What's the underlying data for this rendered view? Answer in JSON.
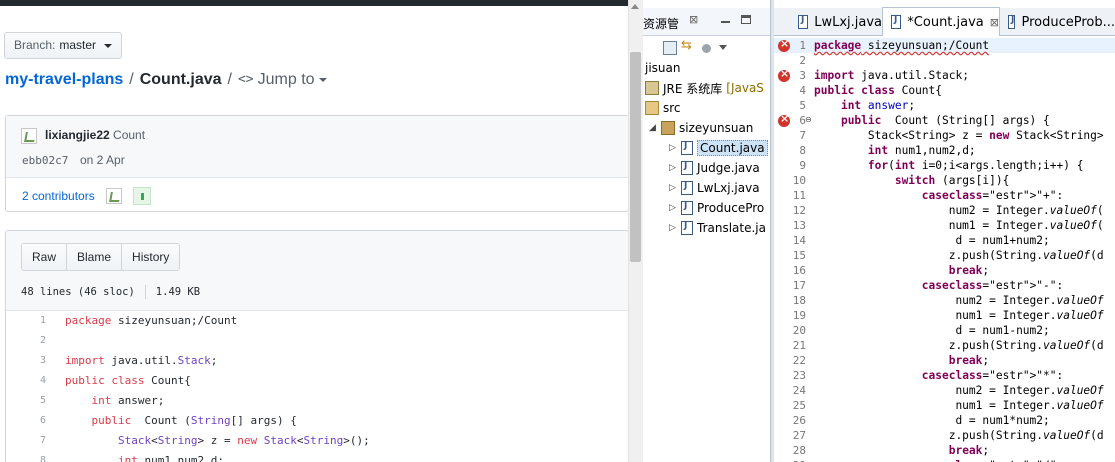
{
  "github": {
    "branch_label": "Branch:",
    "branch_name": "master",
    "repo_name": "my-travel-plans",
    "path_sep": "/",
    "file_name": "Count.java",
    "jump_code": "<>",
    "jump_label": "Jump to",
    "commit": {
      "author": "lixiangjie22",
      "message": "Count",
      "sha": "ebb02c7",
      "date": "on 2 Apr",
      "contributors": "2 contributors"
    },
    "file_actions": [
      "Raw",
      "Blame",
      "History"
    ],
    "lines_info": "48 lines (46 sloc)",
    "size_info": "1.49 KB",
    "code_lines": [
      {
        "n": "1",
        "text": "package sizeyunsuan;/Count"
      },
      {
        "n": "2",
        "text": ""
      },
      {
        "n": "3",
        "text": "import java.util.Stack;"
      },
      {
        "n": "4",
        "text": "public class Count{"
      },
      {
        "n": "5",
        "text": "    int answer;"
      },
      {
        "n": "6",
        "text": "    public  Count (String[] args) {"
      },
      {
        "n": "7",
        "text": "        Stack<String> z = new Stack<String>();"
      },
      {
        "n": "8",
        "text": "        int num1,num2,d;"
      }
    ]
  },
  "eclipse": {
    "explorer_title": "资源管",
    "explorer_close": "⊠",
    "tree": {
      "project": "jisuan",
      "jre": "JRE 系统库",
      "jre_suffix": "[JavaS",
      "src": "src",
      "package": "sizeyunsuan",
      "files": [
        "Count.java",
        "Judge.java",
        "LwLxj.java",
        "ProducePro",
        "Translate.ja"
      ]
    },
    "tabs": [
      {
        "label": "LwLxj.java",
        "active": false
      },
      {
        "label": "*Count.java",
        "active": true
      },
      {
        "label": "ProduceProb...",
        "active": false
      }
    ],
    "tab_close": "⊠",
    "code_lines": [
      {
        "n": "1",
        "text": "package sizeyunsuan;/Count"
      },
      {
        "n": "2",
        "text": ""
      },
      {
        "n": "3",
        "text": "import java.util.Stack;"
      },
      {
        "n": "4",
        "text": "public class Count{"
      },
      {
        "n": "5",
        "text": "    int answer;"
      },
      {
        "n": "6",
        "text": "    public  Count (String[] args) {"
      },
      {
        "n": "7",
        "text": "        Stack<String> z = new Stack<String>"
      },
      {
        "n": "8",
        "text": "        int num1,num2,d;"
      },
      {
        "n": "9",
        "text": "        for(int i=0;i<args.length;i++) {"
      },
      {
        "n": "10",
        "text": "            switch (args[i]){"
      },
      {
        "n": "11",
        "text": "                case\"+\":"
      },
      {
        "n": "12",
        "text": "                    num2 = Integer.valueOf("
      },
      {
        "n": "13",
        "text": "                    num1 = Integer.valueOf("
      },
      {
        "n": "14",
        "text": "                     d = num1+num2;"
      },
      {
        "n": "15",
        "text": "                    z.push(String.valueOf(d"
      },
      {
        "n": "16",
        "text": "                    break;"
      },
      {
        "n": "17",
        "text": "                case\"-\":"
      },
      {
        "n": "18",
        "text": "                     num2 = Integer.valueOf"
      },
      {
        "n": "19",
        "text": "                     num1 = Integer.valueOf"
      },
      {
        "n": "20",
        "text": "                     d = num1-num2;"
      },
      {
        "n": "21",
        "text": "                    z.push(String.valueOf(d"
      },
      {
        "n": "22",
        "text": "                    break;"
      },
      {
        "n": "23",
        "text": "                case\"*\":"
      },
      {
        "n": "24",
        "text": "                     num2 = Integer.valueOf"
      },
      {
        "n": "25",
        "text": "                     num1 = Integer.valueOf"
      },
      {
        "n": "26",
        "text": "                     d = num1*num2;"
      },
      {
        "n": "27",
        "text": "                    z.push(String.valueOf(d"
      },
      {
        "n": "28",
        "text": "                    break;"
      },
      {
        "n": "29",
        "text": "                case\"/\":"
      }
    ],
    "error_lines": [
      "1",
      "3",
      "6"
    ]
  }
}
